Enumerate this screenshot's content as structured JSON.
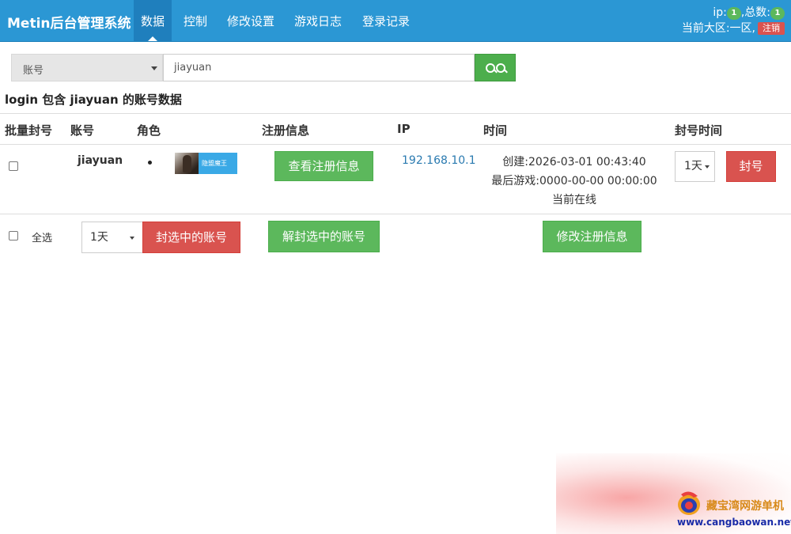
{
  "app": {
    "title": "Metin后台管理系统",
    "nav": [
      {
        "label": "数据",
        "active": true
      },
      {
        "label": "控制"
      },
      {
        "label": "修改设置"
      },
      {
        "label": "游戏日志"
      },
      {
        "label": "登录记录"
      }
    ],
    "status": {
      "ip_label": "ip:",
      "ip_count": "1",
      "total_label": ",总数:",
      "total_count": "1",
      "region_text": "当前大区:一区,",
      "logout_label": "注销"
    }
  },
  "search": {
    "field_select": "账号",
    "query_value": "jiayuan",
    "button_icon": "search-icon"
  },
  "result_title": "login 包含 jiayuan 的账号数据",
  "table": {
    "headers": [
      "批量封号",
      "账号",
      "角色",
      "注册信息",
      "IP",
      "时间",
      "封号时间"
    ],
    "rows": [
      {
        "checked": false,
        "account": "jiayuan",
        "bullet": "•",
        "character_label": "隐盟魔王",
        "reg_button": "查看注册信息",
        "ip": "192.168.10.1",
        "created": "创建:2026-03-01 00:43:40",
        "last_game": "最后游戏:0000-00-00 00:00:00",
        "online": "当前在线",
        "ban_duration": "1天",
        "ban_button": "封号"
      }
    ]
  },
  "bulk": {
    "select_all_label": "全选",
    "duration": "1天",
    "ban_selected": "封选中的账号",
    "unban_selected": "解封选中的账号",
    "edit_reg": "修改注册信息"
  },
  "watermark": {
    "name": "藏宝湾网游单机",
    "url": "www.cangbaowan.net"
  },
  "colors": {
    "navbar": "#2b97d4",
    "nav_active": "#1f7fbd",
    "green": "#5cb85c",
    "red": "#d9534f",
    "link": "#2a7ab0"
  }
}
